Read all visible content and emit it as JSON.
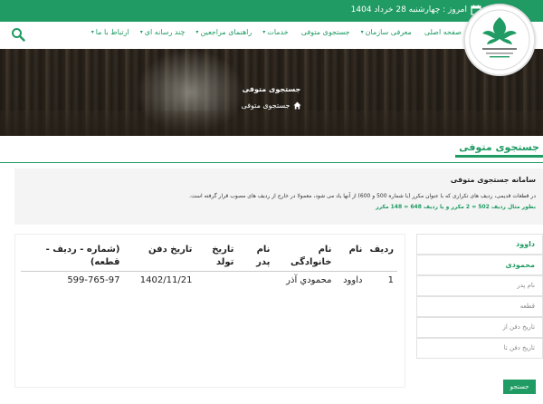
{
  "topbar": {
    "date": "امروز : چهارشنبه 28 خرداد 1404"
  },
  "nav": {
    "items": [
      {
        "label": "صفحه اصلی",
        "caret": ""
      },
      {
        "label": "معرفی سازمان",
        "caret": "▾"
      },
      {
        "label": "جستجوی متوفی",
        "caret": ""
      },
      {
        "label": "خدمات",
        "caret": "▾"
      },
      {
        "label": "راهنمای مراجعین",
        "caret": "▾"
      },
      {
        "label": "چند رسانه ای",
        "caret": "▾"
      },
      {
        "label": "ارتباط با ما",
        "caret": "▾"
      }
    ]
  },
  "hero": {
    "title": "جستجوی متوفی",
    "breadcrumb": "جستجوی متوفی"
  },
  "page": {
    "title": "جستجوی متوفی"
  },
  "info": {
    "heading": "سامانه جستجوی متوفی",
    "text": "در قطعات قدیمی، ردیف های تکراری که با عنوان مکرر (با شماره 500 و 600) از آنها یاد می شود، معمولا در خارج از ردیف های مصوب قرار گرفته است.",
    "example": "بطور مثال ردیف 502 = 2 مکرر  و  یا ردیف 648 = 148 مکرر"
  },
  "form": {
    "first_name_value": "داوود",
    "last_name_value": "محمودی",
    "father_name_placeholder": "نام پدر",
    "section_placeholder": "قطعه",
    "burial_from_placeholder": "تاریخ دفن از",
    "burial_to_placeholder": "تاریخ دفن تا",
    "submit_label": "جستجو"
  },
  "table": {
    "headers": [
      "ردیف",
      "نام",
      "نام خانوادگی",
      "نام پدر",
      "تاریخ تولد",
      "تاریخ دفن",
      "(شماره - ردیف - قطعه)"
    ],
    "rows": [
      [
        "1",
        "داوود",
        "محمودي آذر",
        "",
        "",
        "1402/11/21",
        "599-765-97"
      ]
    ]
  },
  "colors": {
    "accent": "#1f9b63"
  }
}
